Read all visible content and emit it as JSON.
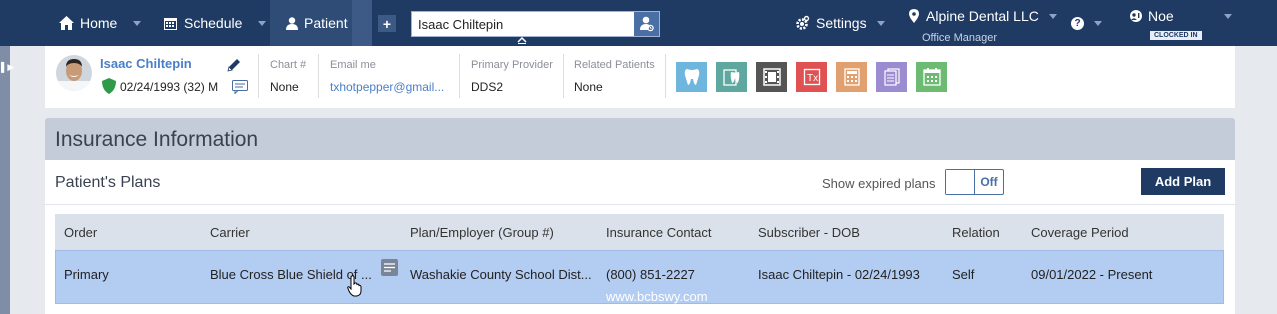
{
  "nav": {
    "home": "Home",
    "schedule": "Schedule",
    "patient": "Patient",
    "plus": "+",
    "search_value": "Isaac Chiltepin",
    "settings": "Settings",
    "location": "Alpine Dental LLC",
    "location_role": "Office Manager",
    "help": "?",
    "user": "Noe",
    "user_status": "CLOCKED IN"
  },
  "patient": {
    "name": "Isaac Chiltepin",
    "dob": "02/24/1993 (32) M",
    "fields": [
      {
        "label": "Chart #",
        "value": "None"
      },
      {
        "label": "Email me",
        "value": "txhotpepper@gmail..."
      },
      {
        "label": "Primary Provider",
        "value": "DDS2"
      },
      {
        "label": "Related Patients",
        "value": "None"
      }
    ]
  },
  "tools": [
    {
      "name": "tooth-chart-icon",
      "color": "#6fb6df"
    },
    {
      "name": "perio-chart-icon",
      "color": "#5fa8a0"
    },
    {
      "name": "imaging-icon",
      "color": "#555555"
    },
    {
      "name": "prescription-icon",
      "color": "#e05252"
    },
    {
      "name": "ledger-icon",
      "color": "#e0a070"
    },
    {
      "name": "documents-icon",
      "color": "#9b8bd1"
    },
    {
      "name": "appointments-icon",
      "color": "#6dbb73"
    }
  ],
  "insurance": {
    "title": "Insurance Information",
    "plans_title": "Patient's Plans",
    "show_expired_label": "Show expired plans",
    "toggle_state": "Off",
    "add_plan": "Add Plan",
    "columns": [
      "Order",
      "Carrier",
      "Plan/Employer (Group #)",
      "Insurance Contact",
      "Subscriber - DOB",
      "Relation",
      "Coverage Period"
    ],
    "rows": [
      {
        "order": "Primary",
        "carrier": "Blue Cross Blue Shield of ...",
        "plan": "Washakie County School Dist...",
        "contact_phone": "(800) 851-2227",
        "contact_web": "www.bcbswy.com",
        "subscriber": "Isaac Chiltepin - 02/24/1993",
        "relation": "Self",
        "coverage": "09/01/2022 - Present"
      }
    ]
  },
  "colors": {
    "nav_bg": "#1f3a63",
    "accent": "#4a7fc7",
    "row_selected": "#b3ccf2"
  }
}
